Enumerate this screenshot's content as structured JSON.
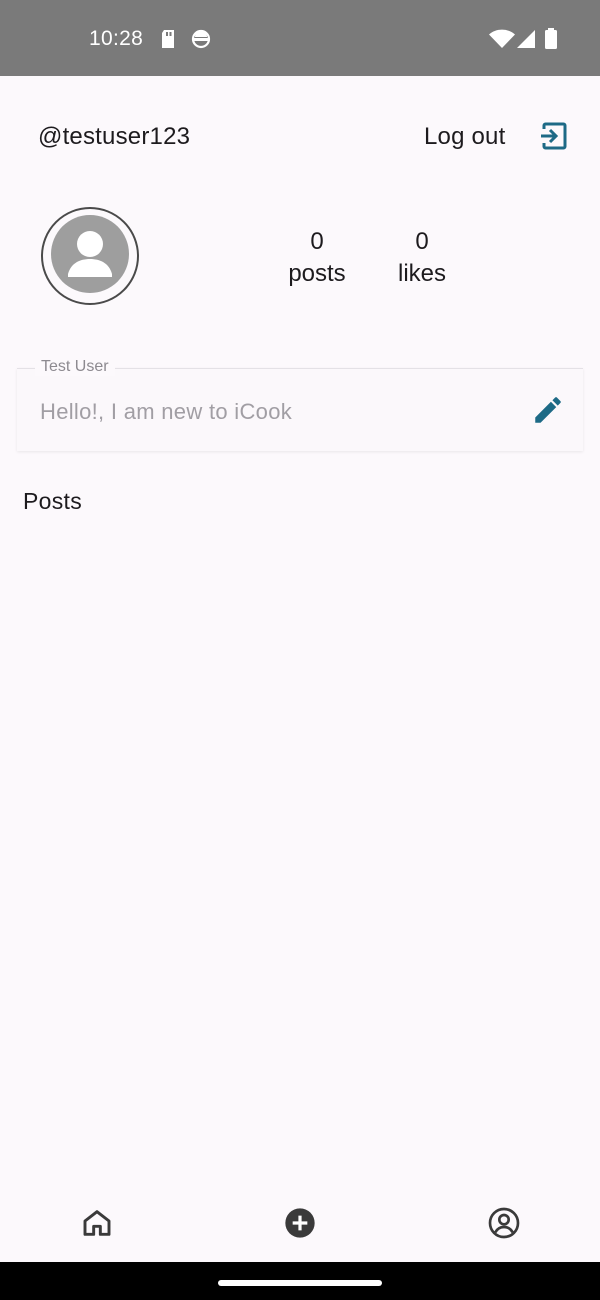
{
  "status_bar": {
    "time": "10:28",
    "icons": [
      "sd-card-icon",
      "app-notification-icon",
      "wifi-icon",
      "cell-signal-icon",
      "battery-icon"
    ]
  },
  "header": {
    "username": "@testuser123",
    "logout_label": "Log out",
    "logout_icon": "logout-icon",
    "accent_color": "#1d6a86"
  },
  "profile": {
    "avatar_icon": "account-avatar-icon",
    "stats": [
      {
        "value": "0",
        "label": "posts"
      },
      {
        "value": "0",
        "label": "likes"
      }
    ],
    "bio": {
      "name_label": "Test User",
      "text": "Hello!, I am new to iCook",
      "edit_icon": "pencil-edit-icon"
    }
  },
  "posts_section": {
    "title": "Posts"
  },
  "bottom_nav": {
    "items": [
      {
        "name": "home",
        "icon": "home-icon"
      },
      {
        "name": "add",
        "icon": "add-circle-icon"
      },
      {
        "name": "profile",
        "icon": "profile-circle-icon"
      }
    ]
  }
}
